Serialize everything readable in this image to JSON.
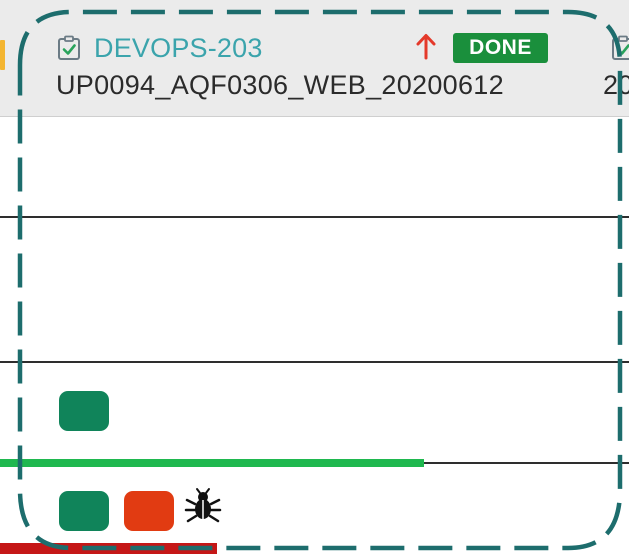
{
  "card": {
    "issue_key": "DEVOPS-203",
    "status": "DONE",
    "summary": "UP0094_AQF0306_WEB_20200612",
    "priority": "high",
    "task_icon": "task-checkbox-icon",
    "priority_icon": "arrow-up-icon"
  },
  "next_card": {
    "summary_fragment": "20",
    "task_icon": "task-checkbox-icon"
  },
  "colors": {
    "issue_key": "#3ba4ac",
    "status_done": "#1a8f3c",
    "priority_high": "#e4392a",
    "chip_green": "#10845a",
    "chip_orange": "#e13b12",
    "progress": "#1fb84f",
    "selection_frame": "#1d6d6d"
  },
  "rows": [
    {
      "chips": []
    },
    {
      "chips": []
    },
    {
      "chips": [
        "green"
      ]
    },
    {
      "chips": [
        "green",
        "orange"
      ],
      "icons": [
        "bug-icon"
      ]
    }
  ]
}
